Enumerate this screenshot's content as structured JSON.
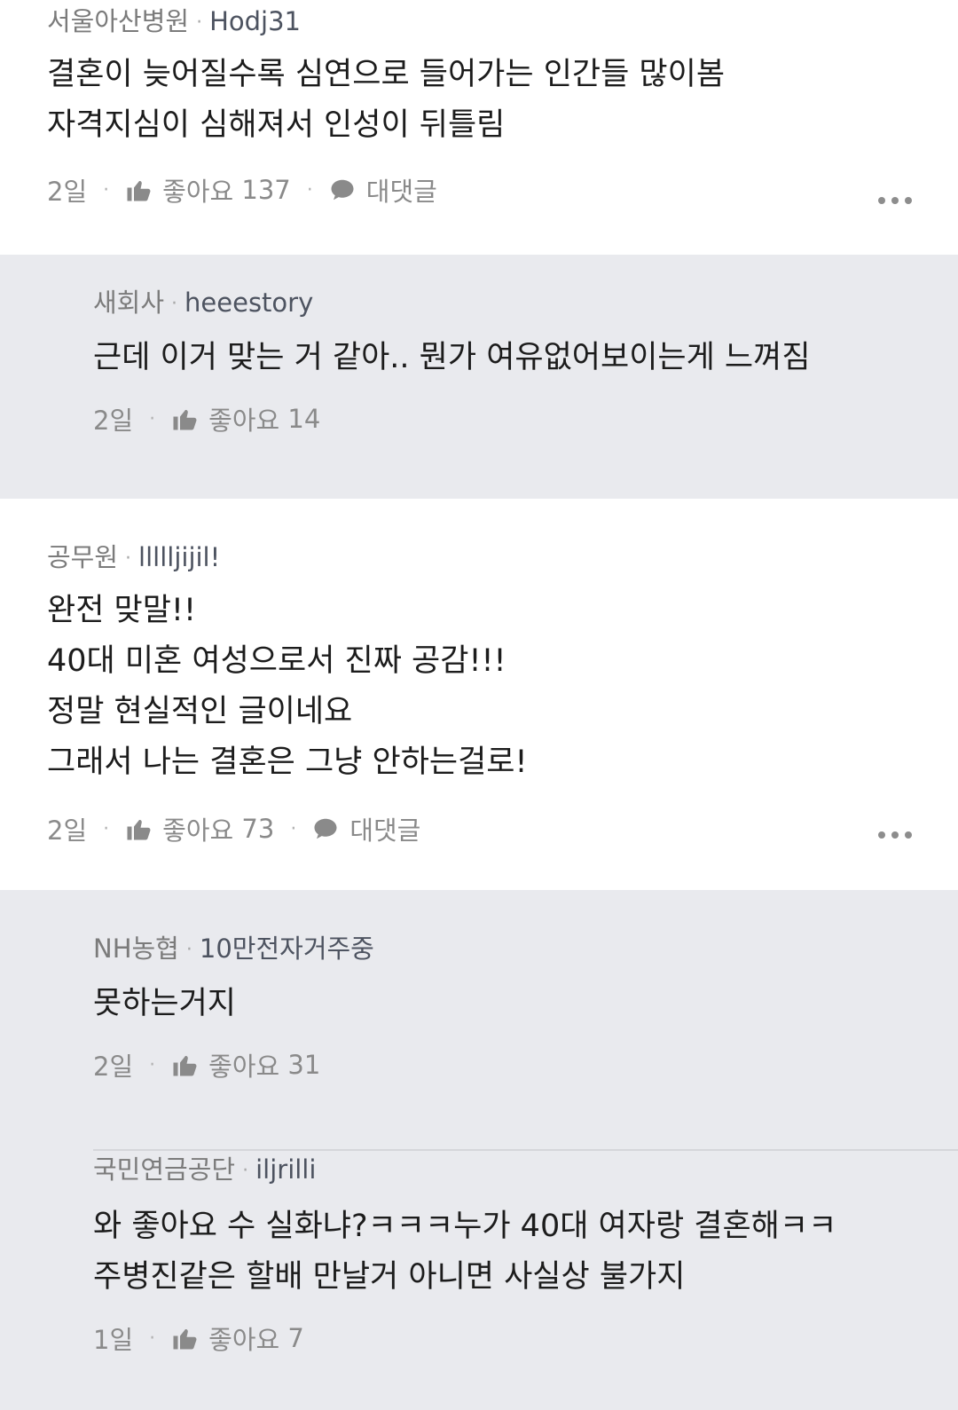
{
  "comments": [
    {
      "org": "서울아산병원",
      "nick": "Hodj31",
      "lines": [
        "결혼이 늦어질수록 심연으로 들어가는 인간들 많이봄",
        "자격지심이 심해져서 인성이 뒤틀림"
      ],
      "age": "2일",
      "like_label": "좋아요",
      "likes": "137",
      "reply_label": "대댓글"
    },
    {
      "org": "새회사",
      "nick": "heeestory",
      "lines": [
        "근데 이거 맞는 거 같아.. 뭔가 여유없어보이는게 느껴짐"
      ],
      "age": "2일",
      "like_label": "좋아요",
      "likes": "14"
    },
    {
      "org": "공무원",
      "nick": "llllljijil!",
      "lines": [
        "완전 맞말!!",
        "40대 미혼 여성으로서 진짜 공감!!!",
        "정말 현실적인 글이네요",
        "그래서 나는 결혼은 그냥 안하는걸로!"
      ],
      "age": "2일",
      "like_label": "좋아요",
      "likes": "73",
      "reply_label": "대댓글"
    },
    {
      "org": "NH농협",
      "nick": "10만전자거주중",
      "lines": [
        "못하는거지"
      ],
      "age": "2일",
      "like_label": "좋아요",
      "likes": "31"
    },
    {
      "org": "국민연금공단",
      "nick": "iljrilli",
      "lines": [
        "와 좋아요 수 실화냐?ㅋㅋㅋ누가 40대 여자랑 결혼해ㅋㅋ",
        "주병진같은 할배 만날거 아니면 사실상 불가지"
      ],
      "age": "1일",
      "like_label": "좋아요",
      "likes": "7"
    }
  ],
  "icons": {
    "like": "thumbs-up-icon",
    "reply": "speech-bubble-icon",
    "more": "more-dots-icon"
  },
  "colors": {
    "reply_bg": "#e9eaee",
    "text": "#1c1c1c",
    "meta": "#7b7b7b"
  }
}
